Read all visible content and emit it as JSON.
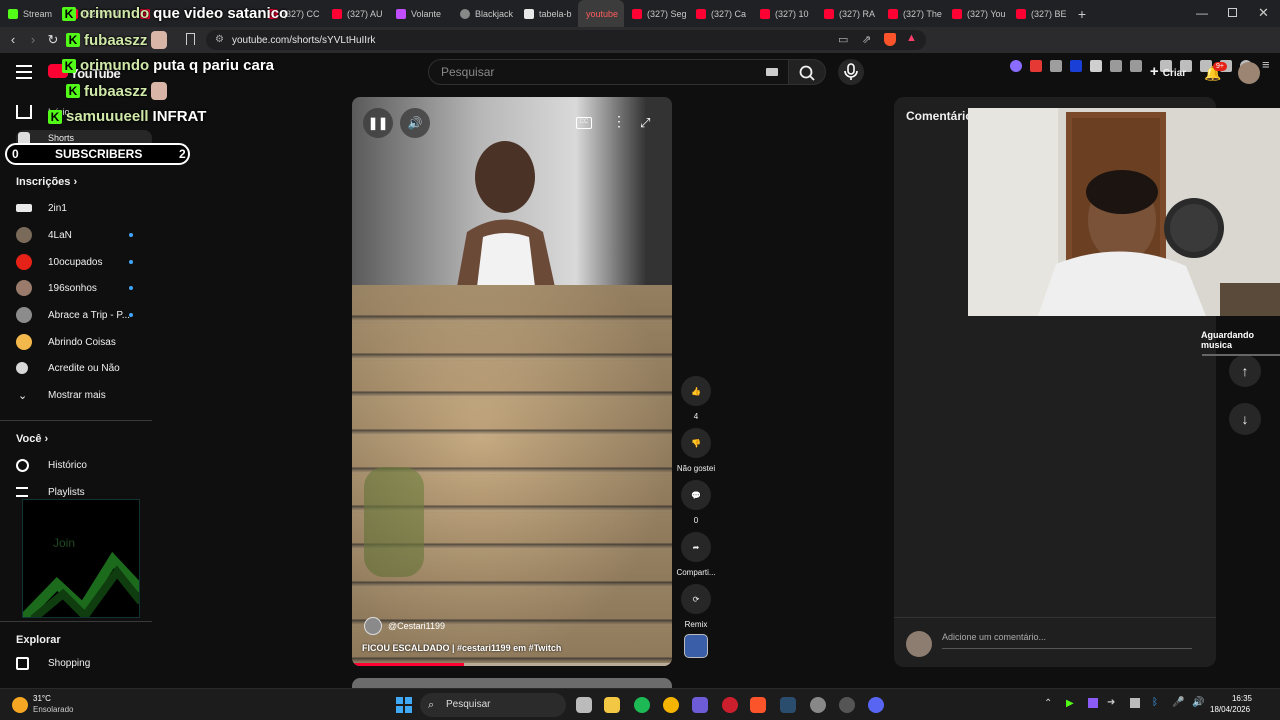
{
  "browser": {
    "tabs": [
      {
        "label": "Stream"
      },
      {
        "label": "(327) AU"
      },
      {
        "label": ""
      },
      {
        "label": "(327) CC"
      },
      {
        "label": "(327) AU"
      },
      {
        "label": "Volante"
      },
      {
        "label": "Blackjack"
      },
      {
        "label": "tabela-b"
      },
      {
        "label": "youtube"
      },
      {
        "label": "(327) Seg"
      },
      {
        "label": "(327) Ca"
      },
      {
        "label": "(327) 10"
      },
      {
        "label": "(327) RA"
      },
      {
        "label": "(327) The"
      },
      {
        "label": "(327) You"
      },
      {
        "label": "(327) BE"
      }
    ],
    "active_tab_index": 8,
    "url": "youtube.com/shorts/sYVLtHuIIrk"
  },
  "youtube": {
    "logo_text": "YouTube",
    "search_placeholder": "Pesquisar",
    "create_label": "Criar",
    "notifications_badge": "9+",
    "sidebar": {
      "home_label": "Início",
      "shorts_label": "Shorts",
      "subscriptions_heading": "Inscrições",
      "subscriptions": [
        {
          "name": "2in1",
          "new": false,
          "color": "#e9e9e9"
        },
        {
          "name": "4LaN",
          "new": true,
          "color": "#7a6a5a"
        },
        {
          "name": "10ocupados",
          "new": true,
          "color": "#e62117"
        },
        {
          "name": "196sonhos",
          "new": true,
          "color": "#9a7b6b"
        },
        {
          "name": "Abrace a Trip - P...",
          "new": true,
          "color": "#8c8c8c"
        },
        {
          "name": "Abrindo Coisas",
          "new": false,
          "color": "#f2b84b"
        },
        {
          "name": "Acredite ou Não",
          "new": false,
          "color": "#d8d8d8"
        }
      ],
      "show_more_label": "Mostrar mais",
      "you_heading": "Você",
      "you_items": [
        {
          "name": "Histórico"
        },
        {
          "name": "Playlists"
        }
      ],
      "explore_heading": "Explorar",
      "explore_items": [
        {
          "name": "Shopping"
        }
      ]
    },
    "short": {
      "channel": "@Cestari1199",
      "title": "FICOU ESCALDADO | #cestari1199 em #Twitch",
      "progress": 0.35
    },
    "actions": {
      "likes": "4",
      "dislike_label": "Não gostei",
      "comments_count": "0",
      "share_label": "Comparti...",
      "remix_label": "Remix"
    },
    "comments_panel": {
      "title": "Comentários",
      "add_comment_placeholder": "Adicione um comentário..."
    }
  },
  "stream_overlay": {
    "chat": [
      {
        "user": "orimundo",
        "message": "que video satanico"
      },
      {
        "user": "fubaaszz",
        "message": ""
      },
      {
        "user": "orimundo",
        "message": "puta q pariu cara"
      },
      {
        "user": "fubaaszz",
        "message": ""
      },
      {
        "user": "samuuueell",
        "message": "INFRAT"
      }
    ],
    "subscribers": {
      "label": "SUBSCRIBERS",
      "left_value": "0",
      "right_value": "2"
    },
    "join_label": "Join",
    "music_status": "Aguardando musica"
  },
  "taskbar": {
    "weather_temp": "31°C",
    "weather_desc": "Ensolarado",
    "search_label": "Pesquisar",
    "time": "16:35",
    "date": "18/04/2026"
  }
}
